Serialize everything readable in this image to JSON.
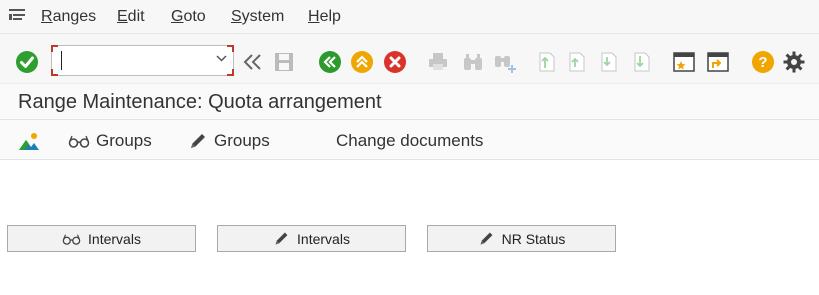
{
  "menu": {
    "items": [
      {
        "label": "Ranges",
        "ul": "R",
        "rest": "anges"
      },
      {
        "label": "Edit",
        "ul": "E",
        "rest": "dit"
      },
      {
        "label": "Goto",
        "ul": "G",
        "rest": "oto"
      },
      {
        "label": "System",
        "ul": "S",
        "rest": "ystem"
      },
      {
        "label": "Help",
        "ul": "H",
        "rest": "elp"
      }
    ]
  },
  "toolbar": {
    "command_value": ""
  },
  "title": "Range Maintenance: Quota arrangement",
  "app_toolbar": {
    "display_groups": "Groups",
    "change_groups": "Groups",
    "change_documents": "Change documents"
  },
  "buttons": {
    "display_intervals": "Intervals",
    "change_intervals": "Intervals",
    "nr_status": "NR Status"
  },
  "colors": {
    "ok_green": "#2e9e2e",
    "nav_green": "#2c9a2c",
    "nav_orange": "#f0a500",
    "cancel_red": "#d9342b",
    "help_orange": "#f0a500"
  }
}
